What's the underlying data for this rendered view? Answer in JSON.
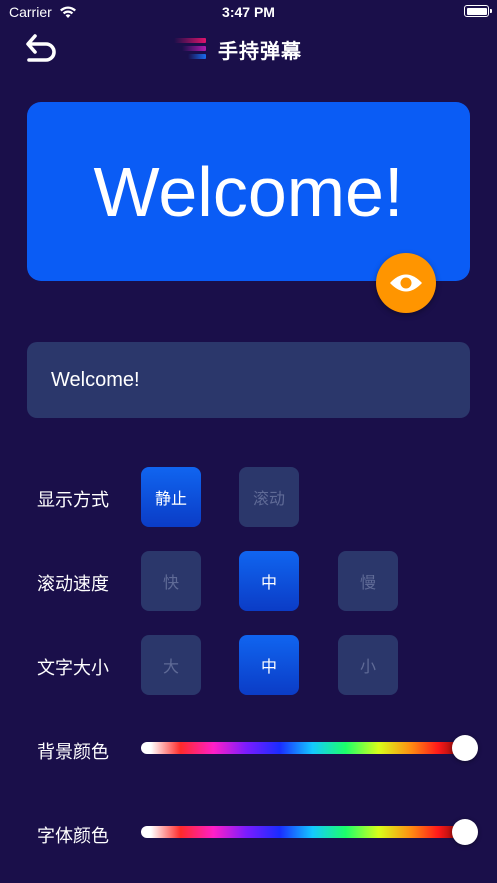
{
  "status_bar": {
    "carrier": "Carrier",
    "time": "3:47 PM"
  },
  "nav": {
    "title": "手持弹幕",
    "back_icon": "back-arrow-icon",
    "logo_colors": [
      "#e0136b",
      "#b01cae",
      "#6a2bd8",
      "#1a6cf0"
    ]
  },
  "preview": {
    "text": "Welcome!",
    "background": "#0a5cf5",
    "preview_icon": "eye-icon",
    "preview_button_color": "#ff9500"
  },
  "input": {
    "value": "Welcome!"
  },
  "display_mode": {
    "label": "显示方式",
    "options": [
      "静止",
      "滚动"
    ],
    "selected": "静止"
  },
  "scroll_speed": {
    "label": "滚动速度",
    "options": [
      "快",
      "中",
      "慢"
    ],
    "selected": "中"
  },
  "text_size": {
    "label": "文字大小",
    "options": [
      "大",
      "中",
      "小"
    ],
    "selected": "中"
  },
  "background_color": {
    "label": "背景颜色",
    "level": 1.0
  },
  "font_color": {
    "label": "字体颜色",
    "level": 1.0
  },
  "colors": {
    "page_bg": "#1a0f4a",
    "control_bg": "#2b376b",
    "accent": "#0b4be0",
    "disabled_text": "#5f6a96"
  }
}
